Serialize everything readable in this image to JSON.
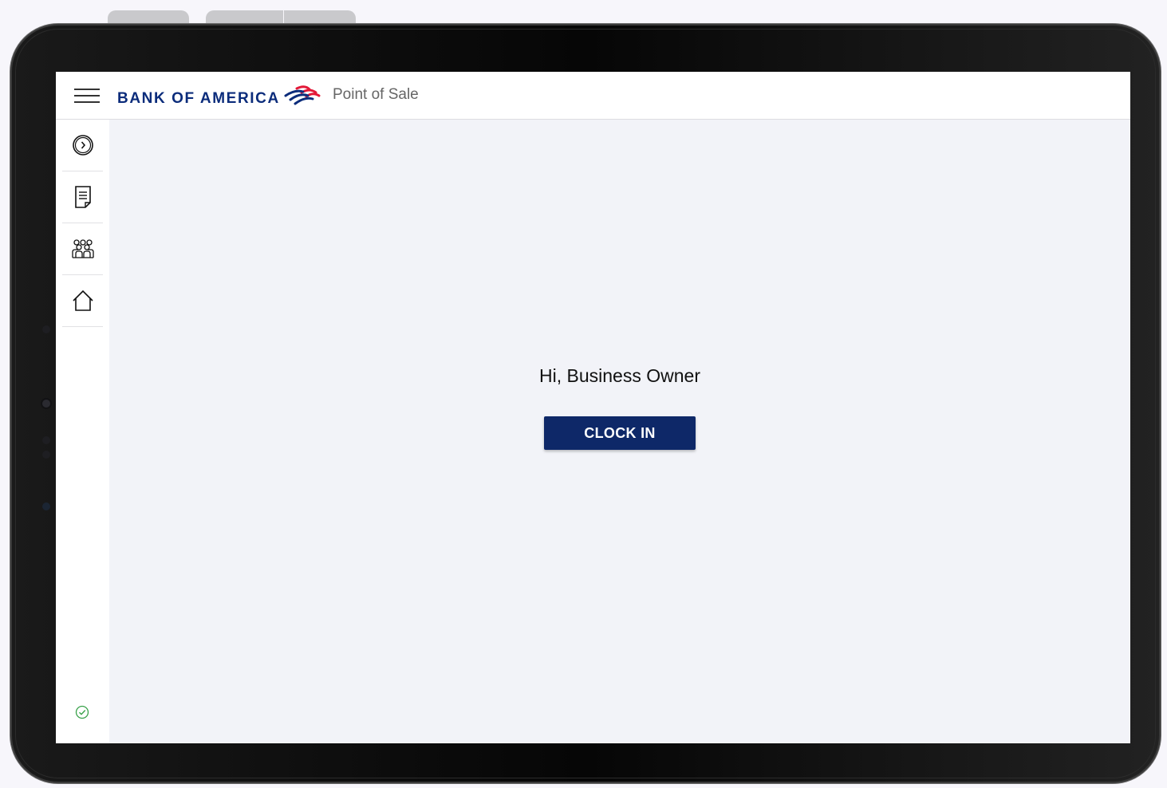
{
  "app": {
    "brand_name": "BANK OF AMERICA",
    "title": "Point of Sale"
  },
  "sidebar": {
    "items": [
      {
        "name": "clock-icon"
      },
      {
        "name": "receipt-icon"
      },
      {
        "name": "people-icon"
      },
      {
        "name": "home-icon"
      }
    ],
    "status_icon": "check-circle-icon"
  },
  "main": {
    "greeting": "Hi, Business Owner",
    "clock_in_label": "CLOCK IN"
  },
  "colors": {
    "brand_blue": "#0e2868",
    "brand_red": "#e31837",
    "status_green": "#3aa24b"
  }
}
